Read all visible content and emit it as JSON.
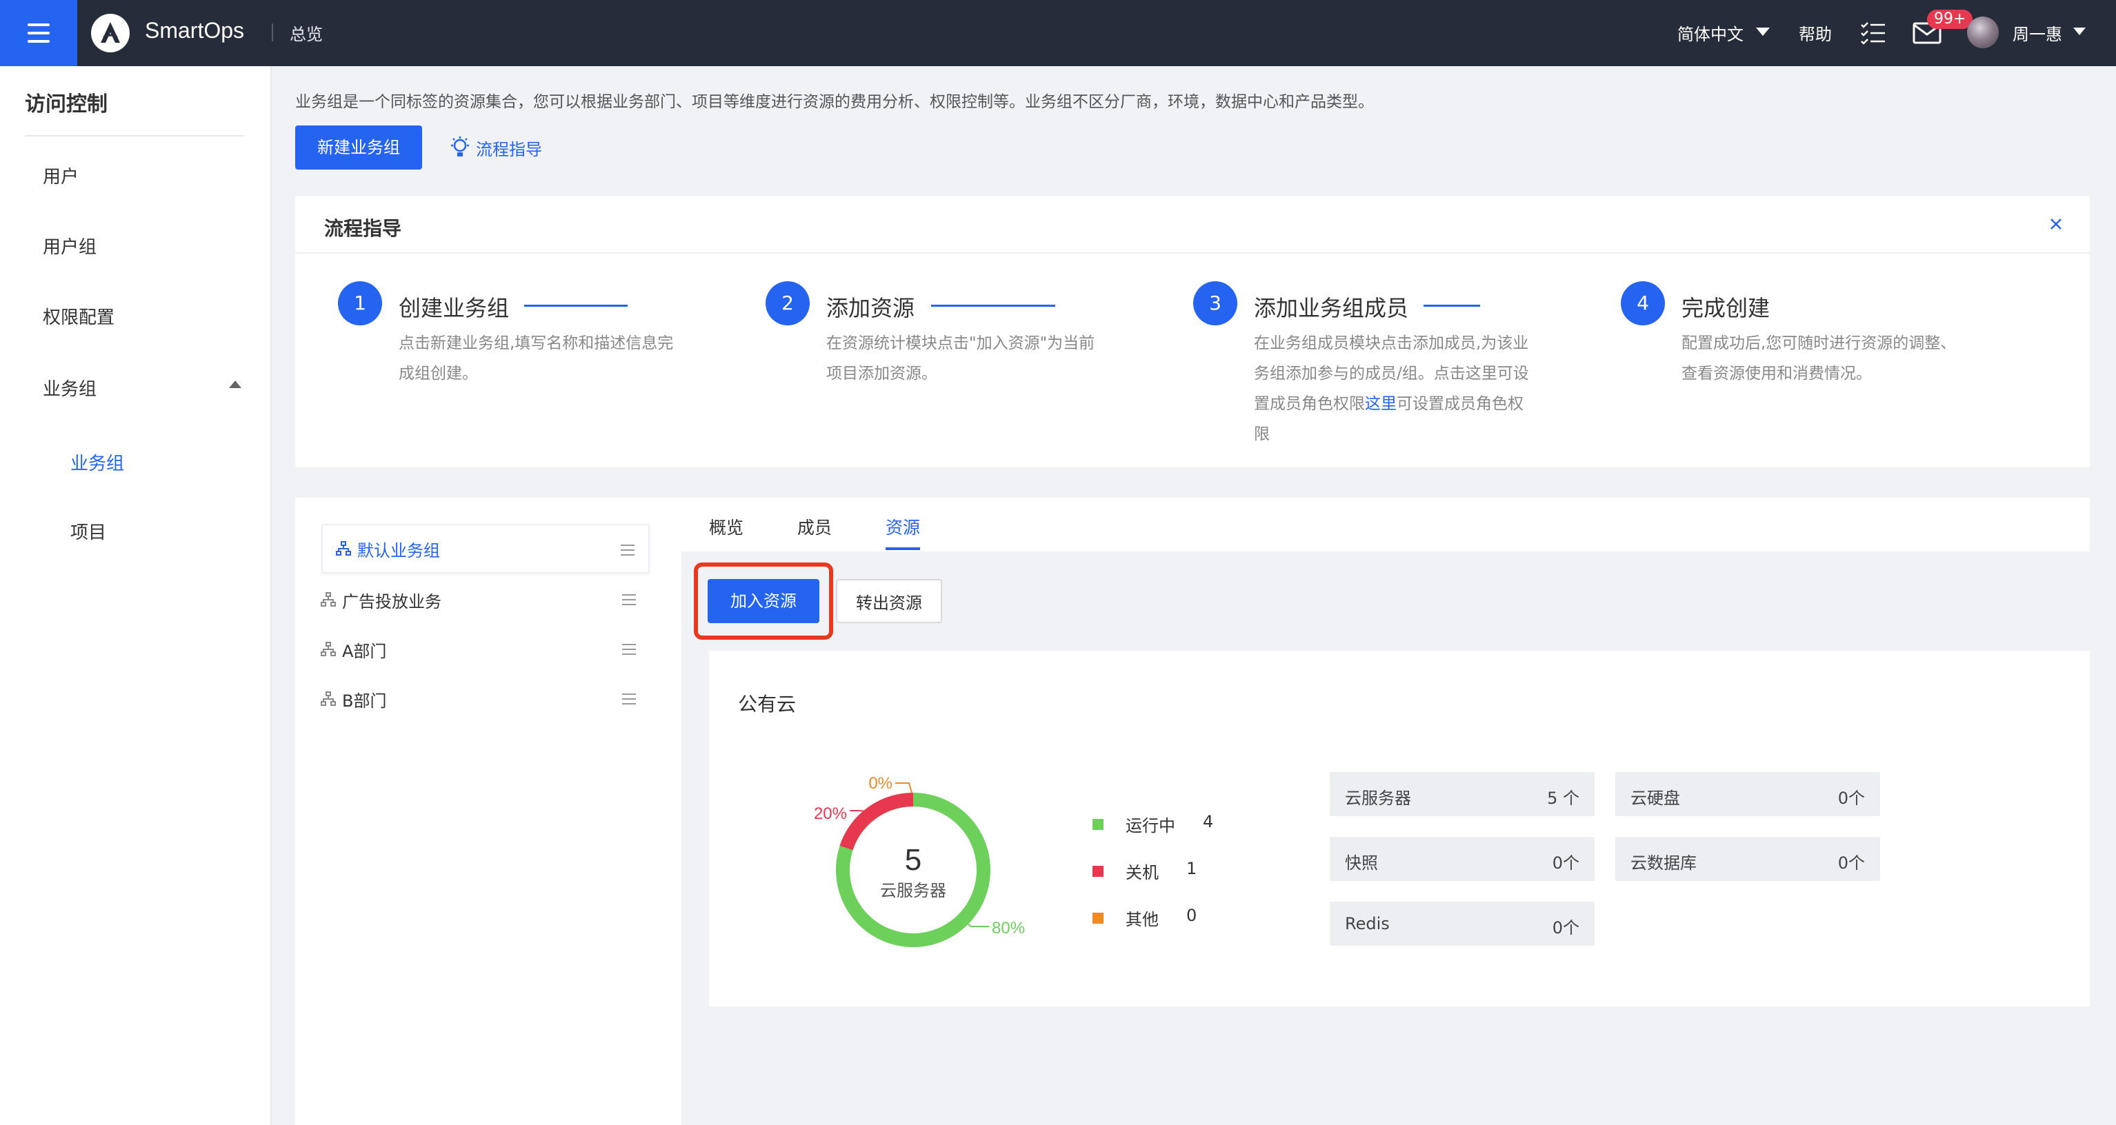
{
  "topbar": {
    "brand": "SmartOps",
    "breadcrumb": "总览",
    "language": "简体中文",
    "help": "帮助",
    "mail_badge": "99+",
    "user_name": "周一惠"
  },
  "sidebar": {
    "title": "访问控制",
    "items": [
      {
        "label": "用户"
      },
      {
        "label": "用户组"
      },
      {
        "label": "权限配置"
      },
      {
        "label": "业务组"
      },
      {
        "label": "业务组"
      },
      {
        "label": "项目"
      }
    ]
  },
  "main": {
    "intro": "业务组是一个同标签的资源集合，您可以根据业务部门、项目等维度进行资源的费用分析、权限控制等。业务组不区分厂商，环境，数据中心和产品类型。",
    "new_group_button": "新建业务组",
    "guide_link": "流程指导"
  },
  "guide": {
    "title": "流程指导",
    "steps": [
      {
        "num": "1",
        "title": "创建业务组",
        "desc": "点击新建业务组,填写名称和描述信息完成组创建。"
      },
      {
        "num": "2",
        "title": "添加资源",
        "desc": "在资源统计模块点击\"加入资源\"为当前项目添加资源。"
      },
      {
        "num": "3",
        "title": "添加业务组成员",
        "desc_before": "在业务组成员模块点击添加成员,为该业务组添加参与的成员/组。点击这里可设置成员角色权限",
        "desc_link": "这里",
        "desc_after": "可设置成员角色权限"
      },
      {
        "num": "4",
        "title": "完成创建",
        "desc": "配置成功后,您可随时进行资源的调整、查看资源使用和消费情况。"
      }
    ]
  },
  "groups": [
    {
      "label": "默认业务组"
    },
    {
      "label": "广告投放业务"
    },
    {
      "label": "A部门"
    },
    {
      "label": "B部门"
    }
  ],
  "tabs": [
    {
      "label": "概览"
    },
    {
      "label": "成员"
    },
    {
      "label": "资源"
    }
  ],
  "actions": {
    "add_resource": "加入资源",
    "transfer_resource": "转出资源"
  },
  "cloud": {
    "title": "公有云",
    "donut_total": "5",
    "donut_label": "云服务器",
    "pct_running": "80%",
    "pct_off": "20%",
    "pct_other": "0%",
    "legend": [
      {
        "label": "运行中",
        "count": "4",
        "color": "#6cd05a"
      },
      {
        "label": "关机",
        "count": "1",
        "color": "#e8384f"
      },
      {
        "label": "其他",
        "count": "0",
        "color": "#f08a24"
      }
    ],
    "resources": [
      {
        "name": "云服务器",
        "value": "5 个"
      },
      {
        "name": "云硬盘",
        "value": "0个"
      },
      {
        "name": "快照",
        "value": "0个"
      },
      {
        "name": "云数据库",
        "value": "0个"
      },
      {
        "name": "Redis",
        "value": "0个"
      }
    ]
  },
  "colors": {
    "primary": "#2464f0",
    "topbar": "#272c3a",
    "highlight": "#e8391e"
  }
}
